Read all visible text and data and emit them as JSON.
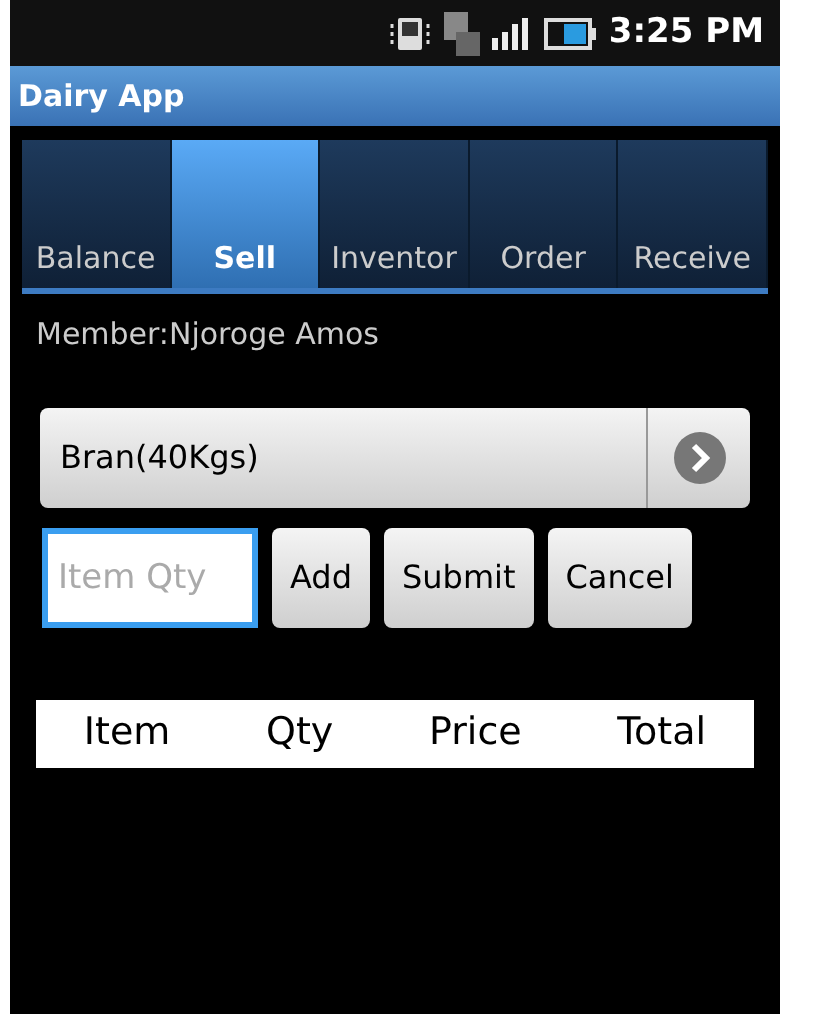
{
  "status_bar": {
    "time": "3:25 PM"
  },
  "window": {
    "title": "Dairy App"
  },
  "tabs": [
    {
      "label": "Balance",
      "selected": false
    },
    {
      "label": "Sell",
      "selected": true
    },
    {
      "label": "Inventor",
      "selected": false
    },
    {
      "label": "Order",
      "selected": false
    },
    {
      "label": "Receive",
      "selected": false
    }
  ],
  "member": "Member:Njoroge Amos",
  "spinner": {
    "value": "Bran(40Kgs)"
  },
  "qty_field": {
    "placeholder": "Item Qty"
  },
  "buttons": [
    "Add",
    "Submit",
    "Cancel"
  ],
  "table": {
    "columns": [
      "Item",
      "Qty",
      "Price",
      "Total"
    ]
  }
}
